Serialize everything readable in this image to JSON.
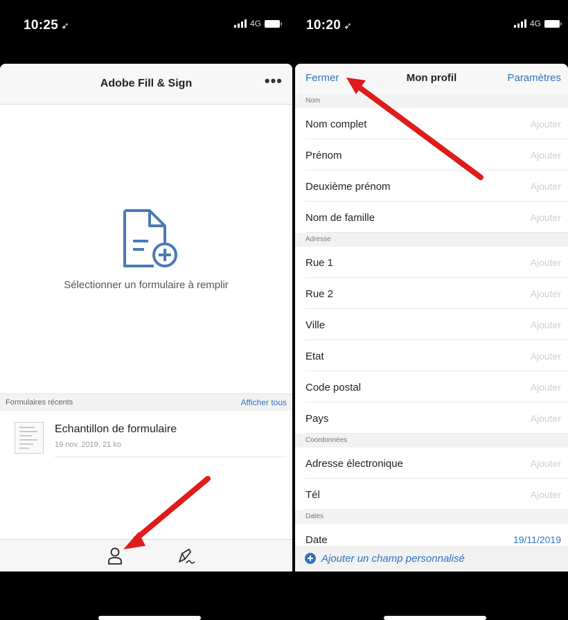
{
  "left_phone": {
    "status": {
      "time": "10:25",
      "network": "4G"
    },
    "header": {
      "title": "Adobe Fill & Sign",
      "more_label": "•••"
    },
    "empty_state": {
      "message": "Sélectionner un formulaire à remplir"
    },
    "recent": {
      "section_label": "Formulaires récents",
      "show_all": "Afficher tous",
      "items": [
        {
          "name": "Echantillon de formulaire",
          "meta": "19 nov. 2019, 21 ko"
        }
      ]
    },
    "tabbar": {
      "tabs": [
        "profile-icon",
        "signature-icon"
      ]
    }
  },
  "right_phone": {
    "status": {
      "time": "10:20",
      "network": "4G"
    },
    "header": {
      "close": "Fermer",
      "title": "Mon profil",
      "settings": "Paramètres"
    },
    "sections": [
      {
        "title": "Nom",
        "rows": [
          {
            "label": "Nom complet",
            "value": "Ajouter"
          },
          {
            "label": "Prénom",
            "value": "Ajouter"
          },
          {
            "label": "Deuxième prénom",
            "value": "Ajouter"
          },
          {
            "label": "Nom de famille",
            "value": "Ajouter"
          }
        ]
      },
      {
        "title": "Adresse",
        "rows": [
          {
            "label": "Rue 1",
            "value": "Ajouter"
          },
          {
            "label": "Rue 2",
            "value": "Ajouter"
          },
          {
            "label": "Ville",
            "value": "Ajouter"
          },
          {
            "label": "Etat",
            "value": "Ajouter"
          },
          {
            "label": "Code postal",
            "value": "Ajouter"
          },
          {
            "label": "Pays",
            "value": "Ajouter"
          }
        ]
      },
      {
        "title": "Coordonnées",
        "rows": [
          {
            "label": "Adresse électronique",
            "value": "Ajouter"
          },
          {
            "label": "Tél",
            "value": "Ajouter"
          }
        ]
      },
      {
        "title": "Dates",
        "rows": [
          {
            "label": "Date",
            "value": "19/11/2019",
            "filled": true
          }
        ]
      }
    ],
    "add_field": "Ajouter un champ personnalisé"
  },
  "colors": {
    "accent": "#2f72c4",
    "placeholder": "#c8cfd8",
    "annotation_arrow": "#e01b1b"
  }
}
